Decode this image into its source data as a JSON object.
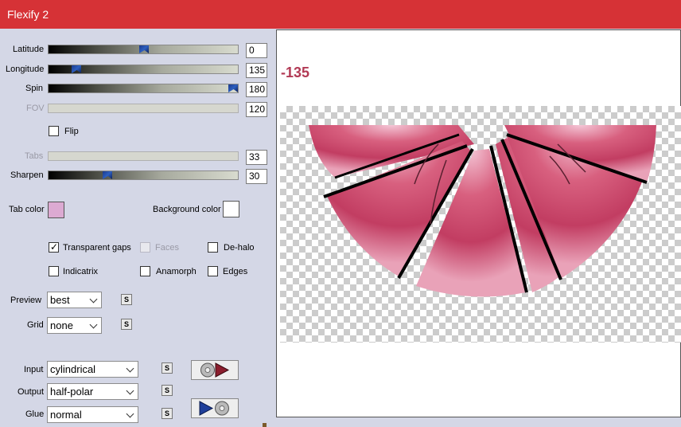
{
  "window": {
    "title": "Flexify 2"
  },
  "colors": {
    "titlebar": "#d63236",
    "panel": "#d4d7e6",
    "tab_color": "#dcaad2",
    "background_color": "#ffffff",
    "angle_text": "#b23a55"
  },
  "sliders": {
    "latitude": {
      "label": "Latitude",
      "value": "0",
      "fraction": 0.5,
      "enabled": true
    },
    "longitude": {
      "label": "Longitude",
      "value": "135",
      "fraction": 0.13,
      "enabled": true
    },
    "spin": {
      "label": "Spin",
      "value": "180",
      "fraction": 1.0,
      "enabled": true
    },
    "fov": {
      "label": "FOV",
      "value": "120",
      "enabled": false
    },
    "tabs": {
      "label": "Tabs",
      "value": "33",
      "enabled": false
    },
    "sharpen": {
      "label": "Sharpen",
      "value": "30",
      "fraction": 0.3,
      "enabled": true
    }
  },
  "flip": {
    "label": "Flip",
    "checked": false
  },
  "tab_color": {
    "label": "Tab color"
  },
  "background_color": {
    "label": "Background color"
  },
  "options": {
    "transparent_gaps": {
      "label": "Transparent gaps",
      "checked": true
    },
    "faces": {
      "label": "Faces",
      "checked": false,
      "enabled": false
    },
    "de_halo": {
      "label": "De-halo",
      "checked": false
    },
    "indicatrix": {
      "label": "Indicatrix",
      "checked": false
    },
    "anamorph": {
      "label": "Anamorph",
      "checked": false
    },
    "edges": {
      "label": "Edges",
      "checked": false
    }
  },
  "preview": {
    "label": "Preview",
    "value": "best"
  },
  "grid": {
    "label": "Grid",
    "value": "none"
  },
  "input": {
    "label": "Input",
    "value": "cylindrical"
  },
  "output": {
    "label": "Output",
    "value": "half-polar"
  },
  "glue": {
    "label": "Glue",
    "value": "normal"
  },
  "link_icon_text": "S",
  "preview_panel": {
    "angle_readout": "-135"
  }
}
